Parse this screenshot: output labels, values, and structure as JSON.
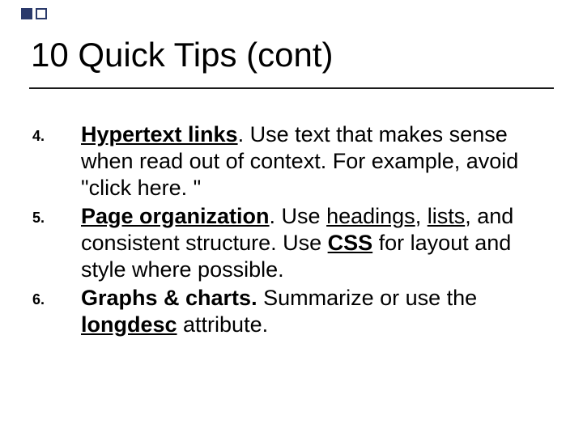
{
  "title": "10 Quick Tips (cont)",
  "items": [
    {
      "num": "4.",
      "lead": "Hypertext links",
      "rest_a": ". Use text that makes sense when read out of context. For example, avoid \"click here. \""
    },
    {
      "num": "5.",
      "lead": "Page organization",
      "rest_a": ". Use ",
      "link_a": "headings",
      "mid_a": ", ",
      "link_b": "lists",
      "mid_b": ", and consistent structure. Use ",
      "link_c": "CSS",
      "rest_b": " for layout and style where possible."
    },
    {
      "num": "6.",
      "lead": "Graphs & charts.",
      "rest_a": " Summarize or use the ",
      "link_a": "longdesc",
      "rest_b": " attribute."
    }
  ]
}
